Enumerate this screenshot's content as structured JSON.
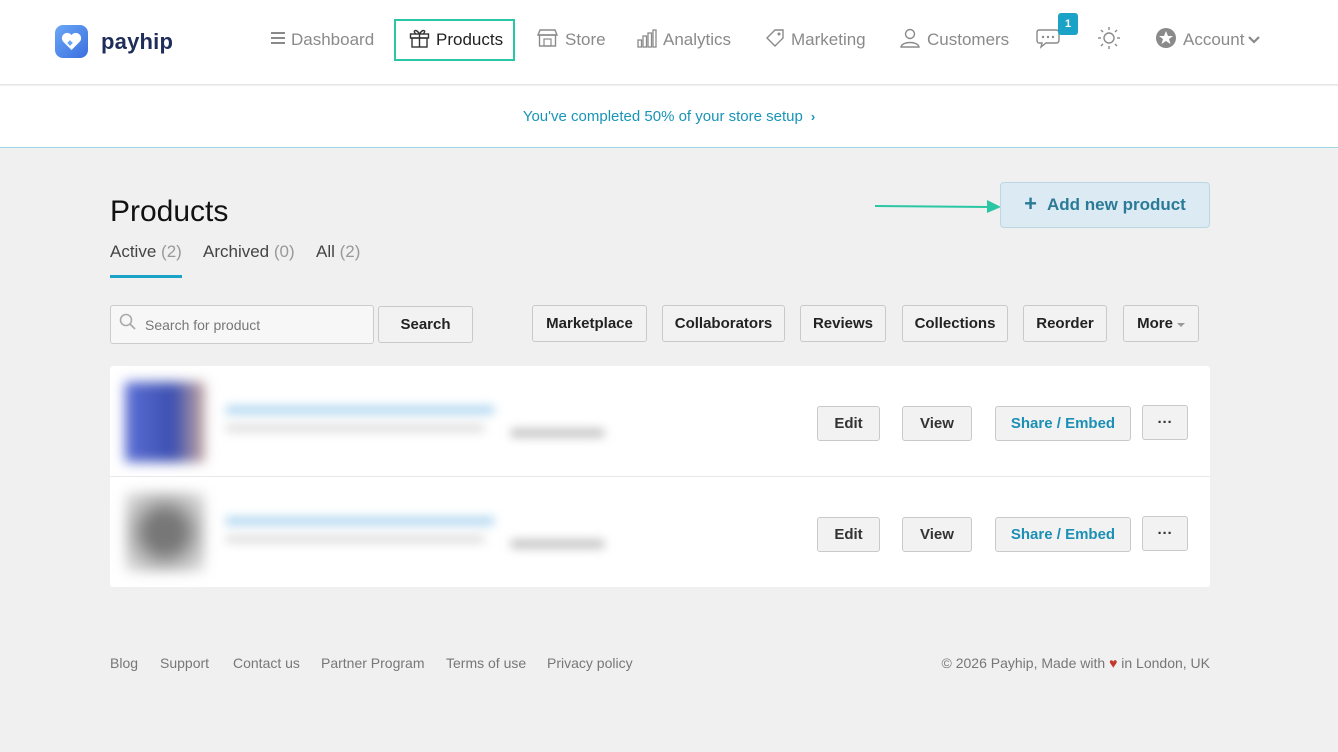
{
  "brand": {
    "name": "payhip"
  },
  "nav": {
    "dashboard": "Dashboard",
    "products": "Products",
    "store": "Store",
    "analytics": "Analytics",
    "marketing": "Marketing",
    "customers": "Customers",
    "chat_badge": "1",
    "account": "Account"
  },
  "setup_banner": {
    "text": "You've completed 50% of your store setup",
    "progress_percent": 50
  },
  "page": {
    "title": "Products",
    "add_button": "Add new product",
    "tabs": [
      {
        "label": "Active",
        "count": "(2)"
      },
      {
        "label": "Archived",
        "count": "(0)"
      },
      {
        "label": "All",
        "count": "(2)"
      }
    ]
  },
  "toolbar": {
    "search_placeholder": "Search for product",
    "search_button": "Search",
    "marketplace": "Marketplace",
    "collaborators": "Collaborators",
    "reviews": "Reviews",
    "collections": "Collections",
    "reorder": "Reorder",
    "more": "More"
  },
  "rows": [
    {
      "edit": "Edit",
      "view": "View",
      "share": "Share / Embed",
      "menu": "···"
    },
    {
      "edit": "Edit",
      "view": "View",
      "share": "Share / Embed",
      "menu": "···"
    }
  ],
  "footer": {
    "links": [
      "Blog",
      "Support",
      "Contact us",
      "Partner Program",
      "Terms of use",
      "Privacy policy"
    ],
    "copyright_prefix": "© 2026 Payhip, Made with",
    "heart": "♥",
    "copyright_suffix": "in London, UK"
  },
  "colors": {
    "accent": "#1aa3c6",
    "highlight": "#2bc6a4",
    "brand_dark": "#1f2d5a"
  },
  "icons": [
    "payhip-logo-icon",
    "hamburger-icon",
    "gift-icon",
    "store-icon",
    "analytics-icon",
    "tag-icon",
    "user-icon",
    "chat-icon",
    "sun-icon",
    "account-badge-icon",
    "chevron-down-icon",
    "search-icon",
    "plus-icon",
    "arrow-right-icon"
  ]
}
